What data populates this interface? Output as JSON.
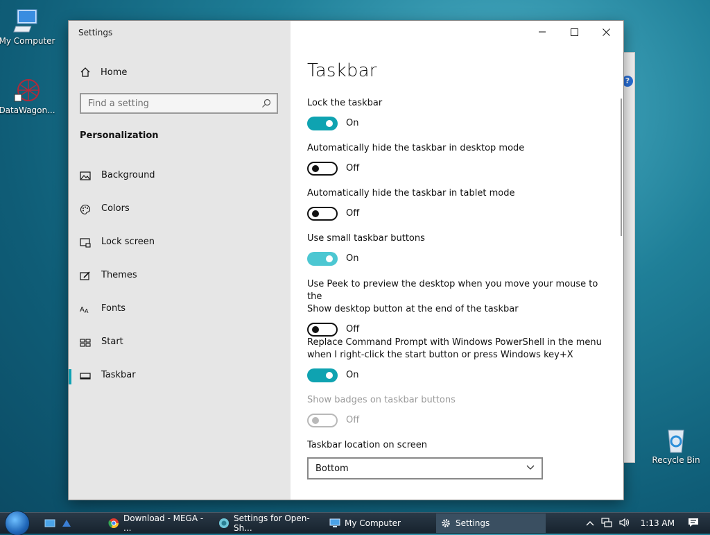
{
  "desktop": {
    "icons": [
      {
        "label": "My Computer",
        "icon": "computer-icon"
      },
      {
        "label": "DataWagon...",
        "icon": "datawagon-icon"
      },
      {
        "label": "Recycle Bin",
        "icon": "recycle-bin-icon"
      }
    ]
  },
  "window": {
    "title": "Settings",
    "buttons": {
      "minimize": "minimize-icon",
      "maximize": "maximize-icon",
      "close": "close-icon"
    }
  },
  "sidebar": {
    "home_label": "Home",
    "search_placeholder": "Find a setting",
    "section_title": "Personalization",
    "items": [
      {
        "label": "Background",
        "icon": "background-icon"
      },
      {
        "label": "Colors",
        "icon": "palette-icon"
      },
      {
        "label": "Lock screen",
        "icon": "lock-screen-icon"
      },
      {
        "label": "Themes",
        "icon": "themes-icon"
      },
      {
        "label": "Fonts",
        "icon": "fonts-icon"
      },
      {
        "label": "Start",
        "icon": "start-icon"
      },
      {
        "label": "Taskbar",
        "icon": "taskbar-icon"
      }
    ],
    "active_item": "Taskbar",
    "accent_color": "#11a2b4"
  },
  "content": {
    "title": "Taskbar",
    "settings": [
      {
        "label": "Lock the taskbar",
        "state": "On",
        "on": true
      },
      {
        "label": "Automatically hide the taskbar in desktop mode",
        "state": "Off",
        "on": false
      },
      {
        "label": "Automatically hide the taskbar in tablet mode",
        "state": "Off",
        "on": false
      },
      {
        "label": "Use small taskbar buttons",
        "state": "On",
        "on": true
      },
      {
        "label_line1": "Use Peek to preview the desktop when you move your mouse to the",
        "label_line2": "Show desktop button at the end of the taskbar",
        "state": "Off",
        "on": false
      },
      {
        "label_line1": "Replace Command Prompt with Windows PowerShell in the menu",
        "label_line2": "when I right-click the start button or press Windows key+X",
        "state": "On",
        "on": true
      },
      {
        "label": "Show badges on taskbar buttons",
        "state": "Off",
        "on": false,
        "disabled": true
      }
    ],
    "location_label": "Taskbar location on screen",
    "location_value": "Bottom",
    "toggle_on_color": "#0fa3b1"
  },
  "taskbar": {
    "tasks": [
      {
        "label": "Download - MEGA - ...",
        "icon": "chrome-icon"
      },
      {
        "label": "Settings for Open-Sh...",
        "icon": "open-shell-icon"
      },
      {
        "label": "My Computer",
        "icon": "computer-icon"
      },
      {
        "label": "Settings",
        "icon": "gear-icon"
      }
    ],
    "clock": "1:13 AM"
  }
}
